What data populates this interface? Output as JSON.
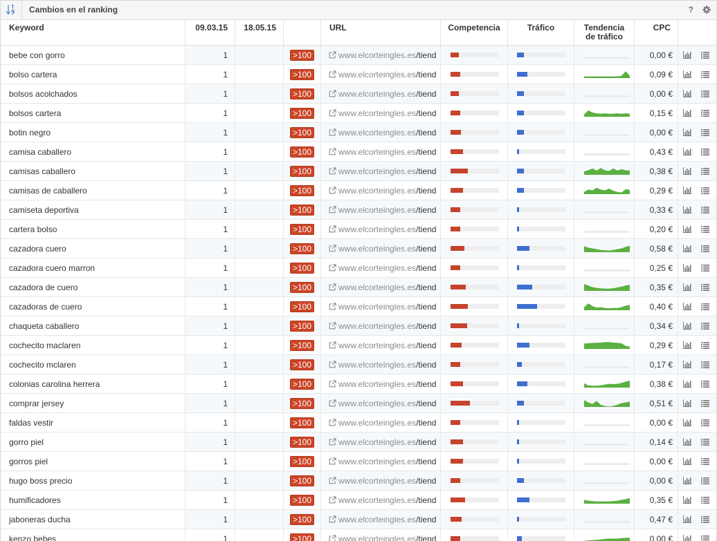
{
  "panel": {
    "title": "Cambios en el ranking",
    "sort_icon": "sort-numeric-icon",
    "help_label": "?",
    "settings_icon": "gear-icon"
  },
  "columns": {
    "keyword": "Keyword",
    "date1": "09.03.15",
    "date2": "18.05.15",
    "url": "URL",
    "competition": "Competencia",
    "traffic": "Tráfico",
    "trend_line1": "Tendencia",
    "trend_line2": "de tráfico",
    "cpc": "CPC"
  },
  "colors": {
    "badge": "#cc4527",
    "competition": "#c6432d",
    "traffic": "#3f6fcf",
    "trend": "#5bb041",
    "track": "#ececec",
    "icon": "#777777",
    "sort_icon": "#4a7fc1"
  },
  "row_icons": {
    "url": "external-link-icon",
    "action_1": "bar-chart-icon",
    "action_2": "list-icon"
  },
  "rows": [
    {
      "keyword": "bebe con gorro",
      "position_date1": "1",
      "change": ">100",
      "url_domain": "www.elcorteingles.es",
      "url_path": "/tiend",
      "competition_pct": 17,
      "traffic_pct": 14,
      "trend": [],
      "cpc": "0,00 €"
    },
    {
      "keyword": "bolso cartera",
      "position_date1": "1",
      "change": ">100",
      "url_domain": "www.elcorteingles.es",
      "url_path": "/tiend",
      "competition_pct": 20,
      "traffic_pct": 21,
      "trend": [
        0.2,
        0.2,
        0.2,
        0.2,
        0.2,
        0.2,
        0.2,
        0.2,
        0.2,
        0.3,
        0.9,
        0.3
      ],
      "cpc": "0,09 €"
    },
    {
      "keyword": "bolsos acolchados",
      "position_date1": "1",
      "change": ">100",
      "url_domain": "www.elcorteingles.es",
      "url_path": "/tiend",
      "competition_pct": 17,
      "traffic_pct": 14,
      "trend": [],
      "cpc": "0,00 €"
    },
    {
      "keyword": "bolsos cartera",
      "position_date1": "1",
      "change": ">100",
      "url_domain": "www.elcorteingles.es",
      "url_path": "/tiend",
      "competition_pct": 20,
      "traffic_pct": 14,
      "trend": [
        0.3,
        0.85,
        0.55,
        0.45,
        0.4,
        0.45,
        0.4,
        0.4,
        0.45,
        0.4,
        0.45,
        0.4
      ],
      "cpc": "0,15 €"
    },
    {
      "keyword": "botin negro",
      "position_date1": "1",
      "change": ">100",
      "url_domain": "www.elcorteingles.es",
      "url_path": "/tiend",
      "competition_pct": 21,
      "traffic_pct": 14,
      "trend": [],
      "cpc": "0,00 €"
    },
    {
      "keyword": "camisa caballero",
      "position_date1": "1",
      "change": ">100",
      "url_domain": "www.elcorteingles.es",
      "url_path": "/tiend",
      "competition_pct": 26,
      "traffic_pct": 4,
      "trend": [],
      "cpc": "0,43 €"
    },
    {
      "keyword": "camisas caballero",
      "position_date1": "1",
      "change": ">100",
      "url_domain": "www.elcorteingles.es",
      "url_path": "/tiend",
      "competition_pct": 36,
      "traffic_pct": 14,
      "trend": [
        0.45,
        0.6,
        0.85,
        0.55,
        0.9,
        0.6,
        0.5,
        0.85,
        0.55,
        0.75,
        0.6,
        0.55
      ],
      "cpc": "0,38 €"
    },
    {
      "keyword": "camisas de caballero",
      "position_date1": "1",
      "change": ">100",
      "url_domain": "www.elcorteingles.es",
      "url_path": "/tiend",
      "competition_pct": 26,
      "traffic_pct": 14,
      "trend": [
        0.3,
        0.6,
        0.5,
        0.85,
        0.6,
        0.5,
        0.75,
        0.45,
        0.3,
        0.2,
        0.65,
        0.55
      ],
      "cpc": "0,29 €"
    },
    {
      "keyword": "camiseta deportiva",
      "position_date1": "1",
      "change": ">100",
      "url_domain": "www.elcorteingles.es",
      "url_path": "/tiend",
      "competition_pct": 20,
      "traffic_pct": 4,
      "trend": [],
      "cpc": "0,33 €"
    },
    {
      "keyword": "cartera bolso",
      "position_date1": "1",
      "change": ">100",
      "url_domain": "www.elcorteingles.es",
      "url_path": "/tiend",
      "competition_pct": 20,
      "traffic_pct": 4,
      "trend": [],
      "cpc": "0,20 €"
    },
    {
      "keyword": "cazadora cuero",
      "position_date1": "1",
      "change": ">100",
      "url_domain": "www.elcorteingles.es",
      "url_path": "/tiend",
      "competition_pct": 29,
      "traffic_pct": 26,
      "trend": [
        0.8,
        0.6,
        0.5,
        0.4,
        0.3,
        0.25,
        0.2,
        0.3,
        0.4,
        0.5,
        0.7,
        0.85
      ],
      "cpc": "0,58 €"
    },
    {
      "keyword": "cazadora cuero marron",
      "position_date1": "1",
      "change": ">100",
      "url_domain": "www.elcorteingles.es",
      "url_path": "/tiend",
      "competition_pct": 20,
      "traffic_pct": 4,
      "trend": [],
      "cpc": "0,25 €"
    },
    {
      "keyword": "cazadora de cuero",
      "position_date1": "1",
      "change": ">100",
      "url_domain": "www.elcorteingles.es",
      "url_path": "/tiend",
      "competition_pct": 31,
      "traffic_pct": 31,
      "trend": [
        0.9,
        0.7,
        0.5,
        0.4,
        0.35,
        0.3,
        0.3,
        0.35,
        0.45,
        0.55,
        0.7,
        0.8
      ],
      "cpc": "0,35 €"
    },
    {
      "keyword": "cazadoras de cuero",
      "position_date1": "1",
      "change": ">100",
      "url_domain": "www.elcorteingles.es",
      "url_path": "/tiend",
      "competition_pct": 36,
      "traffic_pct": 41,
      "trend": [
        0.4,
        0.9,
        0.55,
        0.35,
        0.4,
        0.3,
        0.25,
        0.3,
        0.3,
        0.4,
        0.6,
        0.7
      ],
      "cpc": "0,40 €"
    },
    {
      "keyword": "chaqueta caballero",
      "position_date1": "1",
      "change": ">100",
      "url_domain": "www.elcorteingles.es",
      "url_path": "/tiend",
      "competition_pct": 34,
      "traffic_pct": 4,
      "trend": [],
      "cpc": "0,34 €"
    },
    {
      "keyword": "cochecito maclaren",
      "position_date1": "1",
      "change": ">100",
      "url_domain": "www.elcorteingles.es",
      "url_path": "/tiend",
      "competition_pct": 23,
      "traffic_pct": 26,
      "trend": [
        0.7,
        0.75,
        0.8,
        0.8,
        0.85,
        0.9,
        0.9,
        0.85,
        0.8,
        0.75,
        0.4,
        0.3
      ],
      "cpc": "0,29 €"
    },
    {
      "keyword": "cochecito mclaren",
      "position_date1": "1",
      "change": ">100",
      "url_domain": "www.elcorteingles.es",
      "url_path": "/tiend",
      "competition_pct": 20,
      "traffic_pct": 10,
      "trend": [],
      "cpc": "0,17 €"
    },
    {
      "keyword": "colonias carolina herrera",
      "position_date1": "1",
      "change": ">100",
      "url_domain": "www.elcorteingles.es",
      "url_path": "/tiend",
      "competition_pct": 26,
      "traffic_pct": 21,
      "trend": [
        0.55,
        0.3,
        0.25,
        0.25,
        0.3,
        0.4,
        0.5,
        0.45,
        0.5,
        0.6,
        0.8,
        0.9
      ],
      "cpc": "0,38 €"
    },
    {
      "keyword": "comprar jersey",
      "position_date1": "1",
      "change": ">100",
      "url_domain": "www.elcorteingles.es",
      "url_path": "/tiend",
      "competition_pct": 40,
      "traffic_pct": 14,
      "trend": [
        0.9,
        0.6,
        0.4,
        0.8,
        0.3,
        0.1,
        0.05,
        0.1,
        0.3,
        0.5,
        0.6,
        0.7
      ],
      "cpc": "0,51 €"
    },
    {
      "keyword": "faldas vestir",
      "position_date1": "1",
      "change": ">100",
      "url_domain": "www.elcorteingles.es",
      "url_path": "/tiend",
      "competition_pct": 20,
      "traffic_pct": 4,
      "trend": [],
      "cpc": "0,00 €"
    },
    {
      "keyword": "gorro piel",
      "position_date1": "1",
      "change": ">100",
      "url_domain": "www.elcorteingles.es",
      "url_path": "/tiend",
      "competition_pct": 26,
      "traffic_pct": 4,
      "trend": [],
      "cpc": "0,14 €"
    },
    {
      "keyword": "gorros piel",
      "position_date1": "1",
      "change": ">100",
      "url_domain": "www.elcorteingles.es",
      "url_path": "/tiend",
      "competition_pct": 26,
      "traffic_pct": 4,
      "trend": [],
      "cpc": "0,00 €"
    },
    {
      "keyword": "hugo boss precio",
      "position_date1": "1",
      "change": ">100",
      "url_domain": "www.elcorteingles.es",
      "url_path": "/tiend",
      "competition_pct": 20,
      "traffic_pct": 14,
      "trend": [],
      "cpc": "0,00 €"
    },
    {
      "keyword": "humificadores",
      "position_date1": "1",
      "change": ">100",
      "url_domain": "www.elcorteingles.es",
      "url_path": "/tiend",
      "competition_pct": 30,
      "traffic_pct": 26,
      "trend": [
        0.5,
        0.4,
        0.35,
        0.3,
        0.3,
        0.3,
        0.3,
        0.35,
        0.4,
        0.5,
        0.6,
        0.75
      ],
      "cpc": "0,35 €"
    },
    {
      "keyword": "jaboneras ducha",
      "position_date1": "1",
      "change": ">100",
      "url_domain": "www.elcorteingles.es",
      "url_path": "/tiend",
      "competition_pct": 23,
      "traffic_pct": 4,
      "trend": [],
      "cpc": "0,47 €"
    },
    {
      "keyword": "kenzo bebes",
      "position_date1": "1",
      "change": ">100",
      "url_domain": "www.elcorteingles.es",
      "url_path": "/tiend",
      "competition_pct": 20,
      "traffic_pct": 10,
      "trend": [
        0.2,
        0.25,
        0.3,
        0.35,
        0.4,
        0.45,
        0.5,
        0.5,
        0.5,
        0.55,
        0.6,
        0.6
      ],
      "cpc": "0,00 €"
    }
  ]
}
